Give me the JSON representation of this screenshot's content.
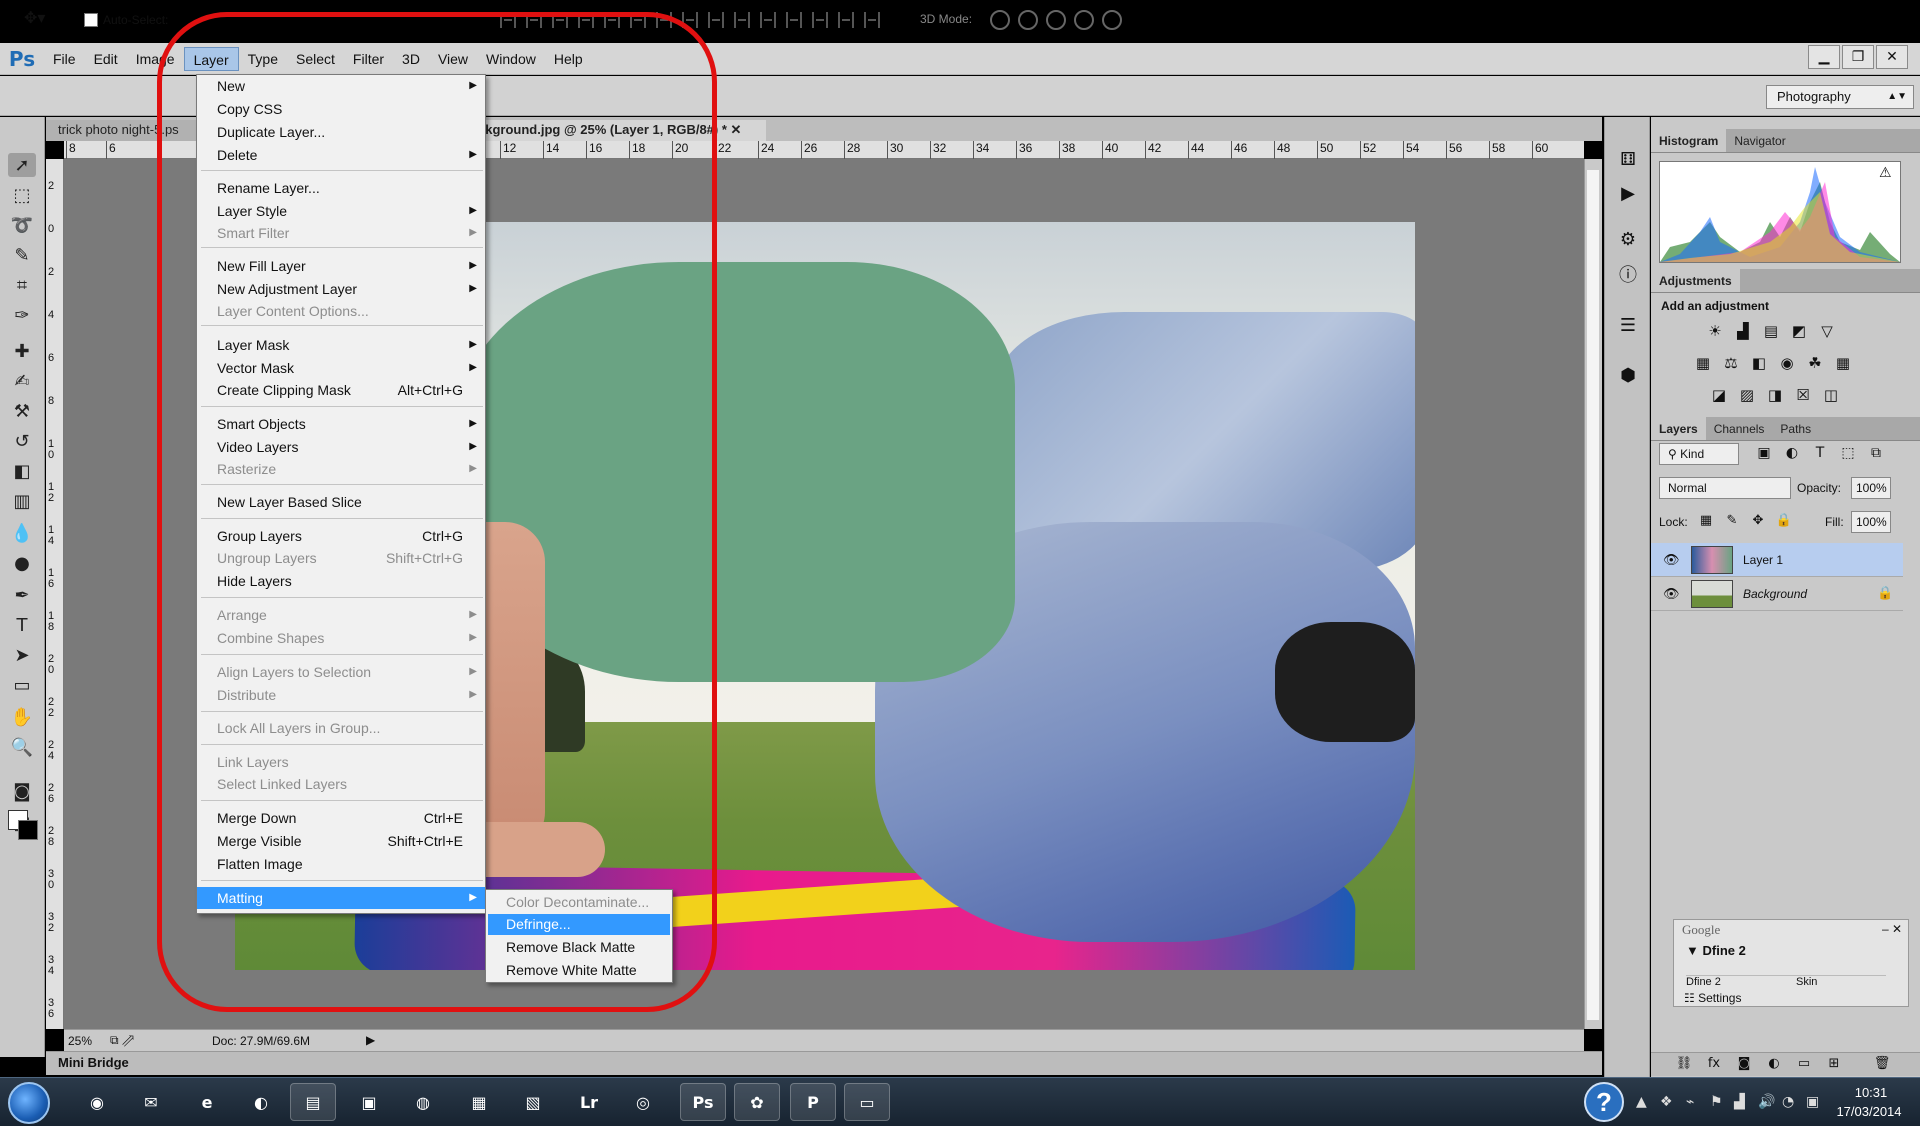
{
  "app": {
    "logo": "Ps"
  },
  "menubar": {
    "items": [
      "File",
      "Edit",
      "Image",
      "Layer",
      "Type",
      "Select",
      "Filter",
      "3D",
      "View",
      "Window",
      "Help"
    ],
    "active": "Layer"
  },
  "window_controls": {
    "minimize": "▁",
    "restore": "❐",
    "close": "✕"
  },
  "options_bar": {
    "auto_select": "Auto-Select:",
    "mode_3d": "3D Mode:",
    "workspace": "Photography"
  },
  "document_tabs": [
    {
      "label": "trick photo night-5.ps"
    },
    {
      "label": "ckground.jpg @ 25% (Layer 1, RGB/8#) *  ✕"
    }
  ],
  "ruler_h_ticks": [
    "8",
    "6",
    "12",
    "14",
    "16",
    "18",
    "20",
    "22",
    "24",
    "26",
    "28",
    "30",
    "32",
    "34",
    "36",
    "38",
    "40",
    "42",
    "44",
    "46",
    "48",
    "50",
    "52",
    "54",
    "56",
    "58",
    "60"
  ],
  "ruler_v_ticks": [
    "2",
    "0",
    "2",
    "4",
    "6",
    "8",
    "10",
    "12",
    "14",
    "16",
    "18",
    "20",
    "22",
    "24",
    "26",
    "28",
    "30",
    "32",
    "34",
    "36"
  ],
  "status": {
    "zoom": "25%",
    "doc_size": "Doc: 27.9M/69.6M"
  },
  "mini_bridge": "Mini Bridge",
  "layer_menu": {
    "items": [
      {
        "label": "New",
        "submenu": true
      },
      {
        "label": "Copy CSS"
      },
      {
        "label": "Duplicate Layer..."
      },
      {
        "label": "Delete",
        "submenu": true
      },
      {
        "label": "Rename Layer..."
      },
      {
        "label": "Layer Style",
        "submenu": true
      },
      {
        "label": "Smart Filter",
        "submenu": true,
        "disabled": true
      },
      {
        "label": "New Fill Layer",
        "submenu": true
      },
      {
        "label": "New Adjustment Layer",
        "submenu": true
      },
      {
        "label": "Layer Content Options...",
        "disabled": true
      },
      {
        "label": "Layer Mask",
        "submenu": true
      },
      {
        "label": "Vector Mask",
        "submenu": true
      },
      {
        "label": "Create Clipping Mask",
        "shortcut": "Alt+Ctrl+G"
      },
      {
        "label": "Smart Objects",
        "submenu": true
      },
      {
        "label": "Video Layers",
        "submenu": true
      },
      {
        "label": "Rasterize",
        "submenu": true,
        "disabled": true
      },
      {
        "label": "New Layer Based Slice"
      },
      {
        "label": "Group Layers",
        "shortcut": "Ctrl+G"
      },
      {
        "label": "Ungroup Layers",
        "shortcut": "Shift+Ctrl+G",
        "disabled": true
      },
      {
        "label": "Hide Layers"
      },
      {
        "label": "Arrange",
        "submenu": true,
        "disabled": true
      },
      {
        "label": "Combine Shapes",
        "submenu": true,
        "disabled": true
      },
      {
        "label": "Align Layers to Selection",
        "submenu": true,
        "disabled": true
      },
      {
        "label": "Distribute",
        "submenu": true,
        "disabled": true
      },
      {
        "label": "Lock All Layers in Group...",
        "disabled": true
      },
      {
        "label": "Link Layers",
        "disabled": true
      },
      {
        "label": "Select Linked Layers",
        "disabled": true
      },
      {
        "label": "Merge Down",
        "shortcut": "Ctrl+E"
      },
      {
        "label": "Merge Visible",
        "shortcut": "Shift+Ctrl+E"
      },
      {
        "label": "Flatten Image"
      },
      {
        "label": "Matting",
        "submenu": true,
        "highlighted": true
      }
    ]
  },
  "matting_submenu": {
    "items": [
      {
        "label": "Color Decontaminate...",
        "disabled": true
      },
      {
        "label": "Defringe...",
        "highlighted": true
      },
      {
        "label": "Remove Black Matte"
      },
      {
        "label": "Remove White Matte"
      }
    ]
  },
  "panels": {
    "histogram_tabs": [
      "Histogram",
      "Navigator"
    ],
    "histogram_warning": "⚠",
    "adjustments_tab": "Adjustments",
    "adjustments_title": "Add an adjustment",
    "layers_tabs": [
      "Layers",
      "Channels",
      "Paths"
    ],
    "kind": "Kind",
    "blend_mode": "Normal",
    "opacity_label": "Opacity:",
    "opacity": "100%",
    "lock_label": "Lock:",
    "fill_label": "Fill:",
    "fill": "100%",
    "layers": [
      {
        "name": "Layer 1",
        "selected": true
      },
      {
        "name": "Background",
        "locked": true
      }
    ]
  },
  "google_widget": {
    "title": "Google",
    "name": "Dfine 2",
    "row_left": "Dfine 2",
    "row_right": "Skin",
    "settings": "Settings"
  },
  "taskbar": {
    "apps": [
      "Chrome",
      "Gmail",
      "IE",
      "Firefox",
      "Explorer",
      "Green",
      "Circle",
      "Blue",
      "Purple",
      "Lr",
      "Red",
      "Ps",
      "Colorful",
      "P",
      "Window"
    ],
    "time": "10:31",
    "date": "17/03/2014"
  },
  "colors": {
    "highlight": "#3399ff",
    "annotation_red": "#e01010",
    "selected_layer": "#b7cdef"
  }
}
